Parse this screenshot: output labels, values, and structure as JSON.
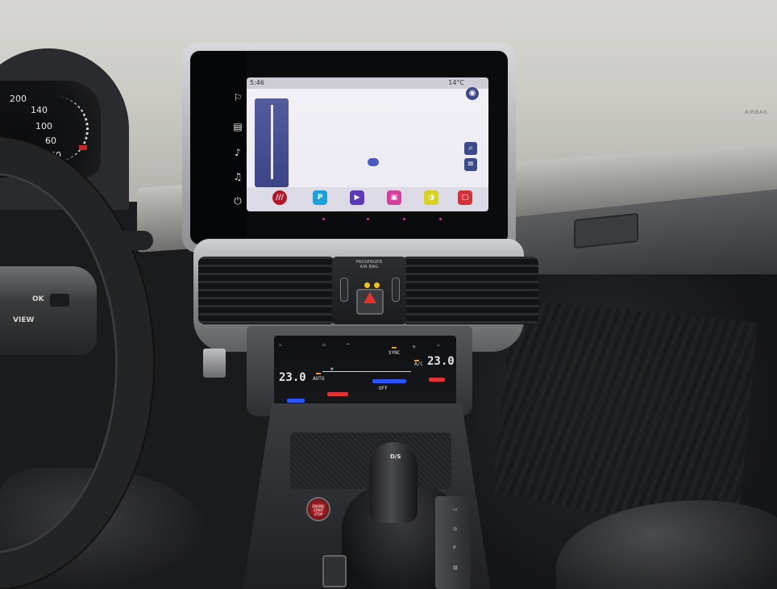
{
  "cluster": {
    "speed_marks": [
      "200",
      "140",
      "100",
      "60",
      "40"
    ]
  },
  "infotainment": {
    "status_left": "5:46",
    "status_right": "14°C"
  },
  "airbag_panel": {
    "label_line1": "PASSENGER",
    "label_line2": "AIR BAG"
  },
  "dash": {
    "airbag_mark": "AIRBAG"
  },
  "climate": {
    "left_temp": "23.0",
    "right_temp": "23.0",
    "auto_label": "AUTO",
    "sync_label": "SYNC",
    "ac_label": "A/C",
    "off_label": "OFF"
  },
  "steering": {
    "view_label": "VIEW",
    "ok_label": "OK"
  },
  "shifter": {
    "gear_label": "D/S"
  },
  "start_button": {
    "label": "ENGINE START STOP"
  },
  "colors": {
    "hazard_red": "#e5322b",
    "climate_amber": "#ee9a2a",
    "airbag_lamp": "#f2c418",
    "heat_red": "#e3333a",
    "cool_blue": "#2a55ff"
  }
}
